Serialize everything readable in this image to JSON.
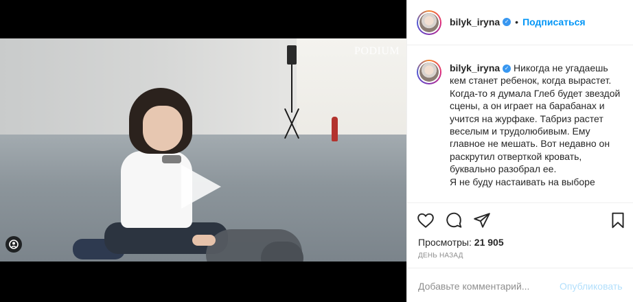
{
  "post": {
    "watermark": "PODIUM",
    "views_label": "Просмотры:",
    "views_count": "21 905",
    "time": "ДЕНЬ НАЗАД"
  },
  "header": {
    "username": "bilyk_iryna",
    "separator": "•",
    "follow_label": "Подписаться"
  },
  "caption": {
    "username": "bilyk_iryna",
    "text": "Никогда не угадаешь кем станет ребенок, когда вырастет. Когда-то я думала Глеб будет звездой сцены, а он играет на барабанах и учится на журфаке. Табриз растет веселым и трудолюбивым. Ему главное не мешать. Вот недавно он раскрутил отверткой кровать, буквально разобрал ее.\nЯ не буду настаивать на выборе"
  },
  "actions": {
    "like": "heart-icon",
    "comment": "comment-icon",
    "share": "share-icon",
    "save": "bookmark-icon"
  },
  "comment": {
    "placeholder": "Добавьте комментарий...",
    "publish_label": "Опубликовать"
  },
  "colors": {
    "accent": "#0095f6",
    "publish_disabled": "#b2dffc",
    "verified": "#3897f0"
  }
}
